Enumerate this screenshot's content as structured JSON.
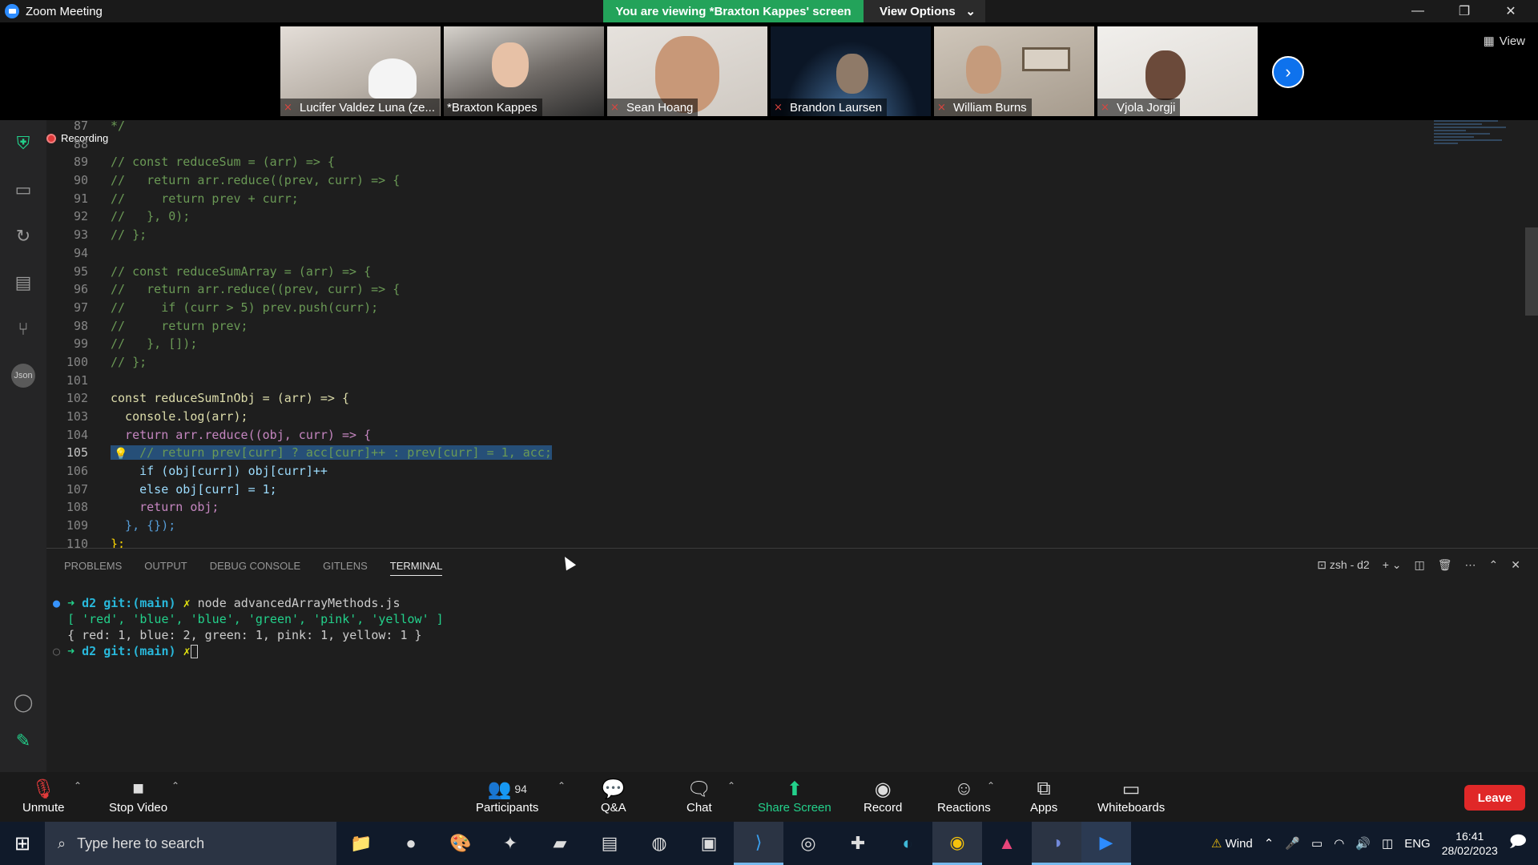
{
  "window": {
    "title": "Zoom Meeting",
    "viewing_banner": "You are viewing *Braxton Kappes' screen",
    "view_options": "View Options",
    "view_label": "View"
  },
  "participants_strip": [
    {
      "name": "Lucifer Valdez Luna (ze...",
      "bg": "#cfc7c0"
    },
    {
      "name": "*Braxton Kappes",
      "bg": "#8a8480"
    },
    {
      "name": "Sean Hoang",
      "bg": "#d9d4cf"
    },
    {
      "name": "Brandon Laursen",
      "bg": "#14243a"
    },
    {
      "name": "William Burns",
      "bg": "#b7aea2"
    },
    {
      "name": "Vjola Jorgji",
      "bg": "#ece9e4"
    }
  ],
  "recording_label": "Recording",
  "editor": {
    "lines": [
      {
        "n": "87",
        "t": "*/"
      },
      {
        "n": "88",
        "t": ""
      },
      {
        "n": "89",
        "t": "// const reduceSum = (arr) => {"
      },
      {
        "n": "90",
        "t": "//   return arr.reduce((prev, curr) => {"
      },
      {
        "n": "91",
        "t": "//     return prev + curr;"
      },
      {
        "n": "92",
        "t": "//   }, 0);"
      },
      {
        "n": "93",
        "t": "// };"
      },
      {
        "n": "94",
        "t": ""
      },
      {
        "n": "95",
        "t": "// const reduceSumArray = (arr) => {"
      },
      {
        "n": "96",
        "t": "//   return arr.reduce((prev, curr) => {"
      },
      {
        "n": "97",
        "t": "//     if (curr > 5) prev.push(curr);"
      },
      {
        "n": "98",
        "t": "//     return prev;"
      },
      {
        "n": "99",
        "t": "//   }, []);"
      },
      {
        "n": "100",
        "t": "// };"
      },
      {
        "n": "101",
        "t": ""
      },
      {
        "n": "102",
        "t": "const reduceSumInObj = (arr) => {"
      },
      {
        "n": "103",
        "t": "  console.log(arr);"
      },
      {
        "n": "104",
        "t": "  return arr.reduce((obj, curr) => {"
      },
      {
        "n": "105",
        "t": "    // return prev[curr] ? acc[curr]++ : prev[curr] = 1, acc;"
      },
      {
        "n": "106",
        "t": "    if (obj[curr]) obj[curr]++"
      },
      {
        "n": "107",
        "t": "    else obj[curr] = 1;"
      },
      {
        "n": "108",
        "t": "    return obj;"
      },
      {
        "n": "109",
        "t": "  }, {});"
      },
      {
        "n": "110",
        "t": "};"
      }
    ]
  },
  "panel": {
    "tabs": [
      "PROBLEMS",
      "OUTPUT",
      "DEBUG CONSOLE",
      "GITLENS",
      "TERMINAL"
    ],
    "active_tab": "TERMINAL",
    "shell": "zsh - d2"
  },
  "terminal": {
    "dir": "d2",
    "git": "git:(main)",
    "command": "node advancedArrayMethods.js",
    "out1": "[ 'red', 'blue', 'blue', 'green', 'pink', 'yellow' ]",
    "out2": "{ red: 1, blue: 2, green: 1, pink: 1, yellow: 1 }"
  },
  "toolbar": {
    "unmute": "Unmute",
    "stop_video": "Stop Video",
    "participants": "Participants",
    "participants_count": "94",
    "qa": "Q&A",
    "chat": "Chat",
    "share_screen": "Share Screen",
    "record": "Record",
    "reactions": "Reactions",
    "apps": "Apps",
    "whiteboards": "Whiteboards",
    "leave": "Leave"
  },
  "taskbar": {
    "search_placeholder": "Type here to search",
    "weather": "Wind",
    "language": "ENG",
    "time": "16:41",
    "date": "28/02/2023"
  },
  "colors": {
    "accent": "#2d8cff",
    "banner_green": "#23a35a",
    "leave_red": "#e02828"
  }
}
